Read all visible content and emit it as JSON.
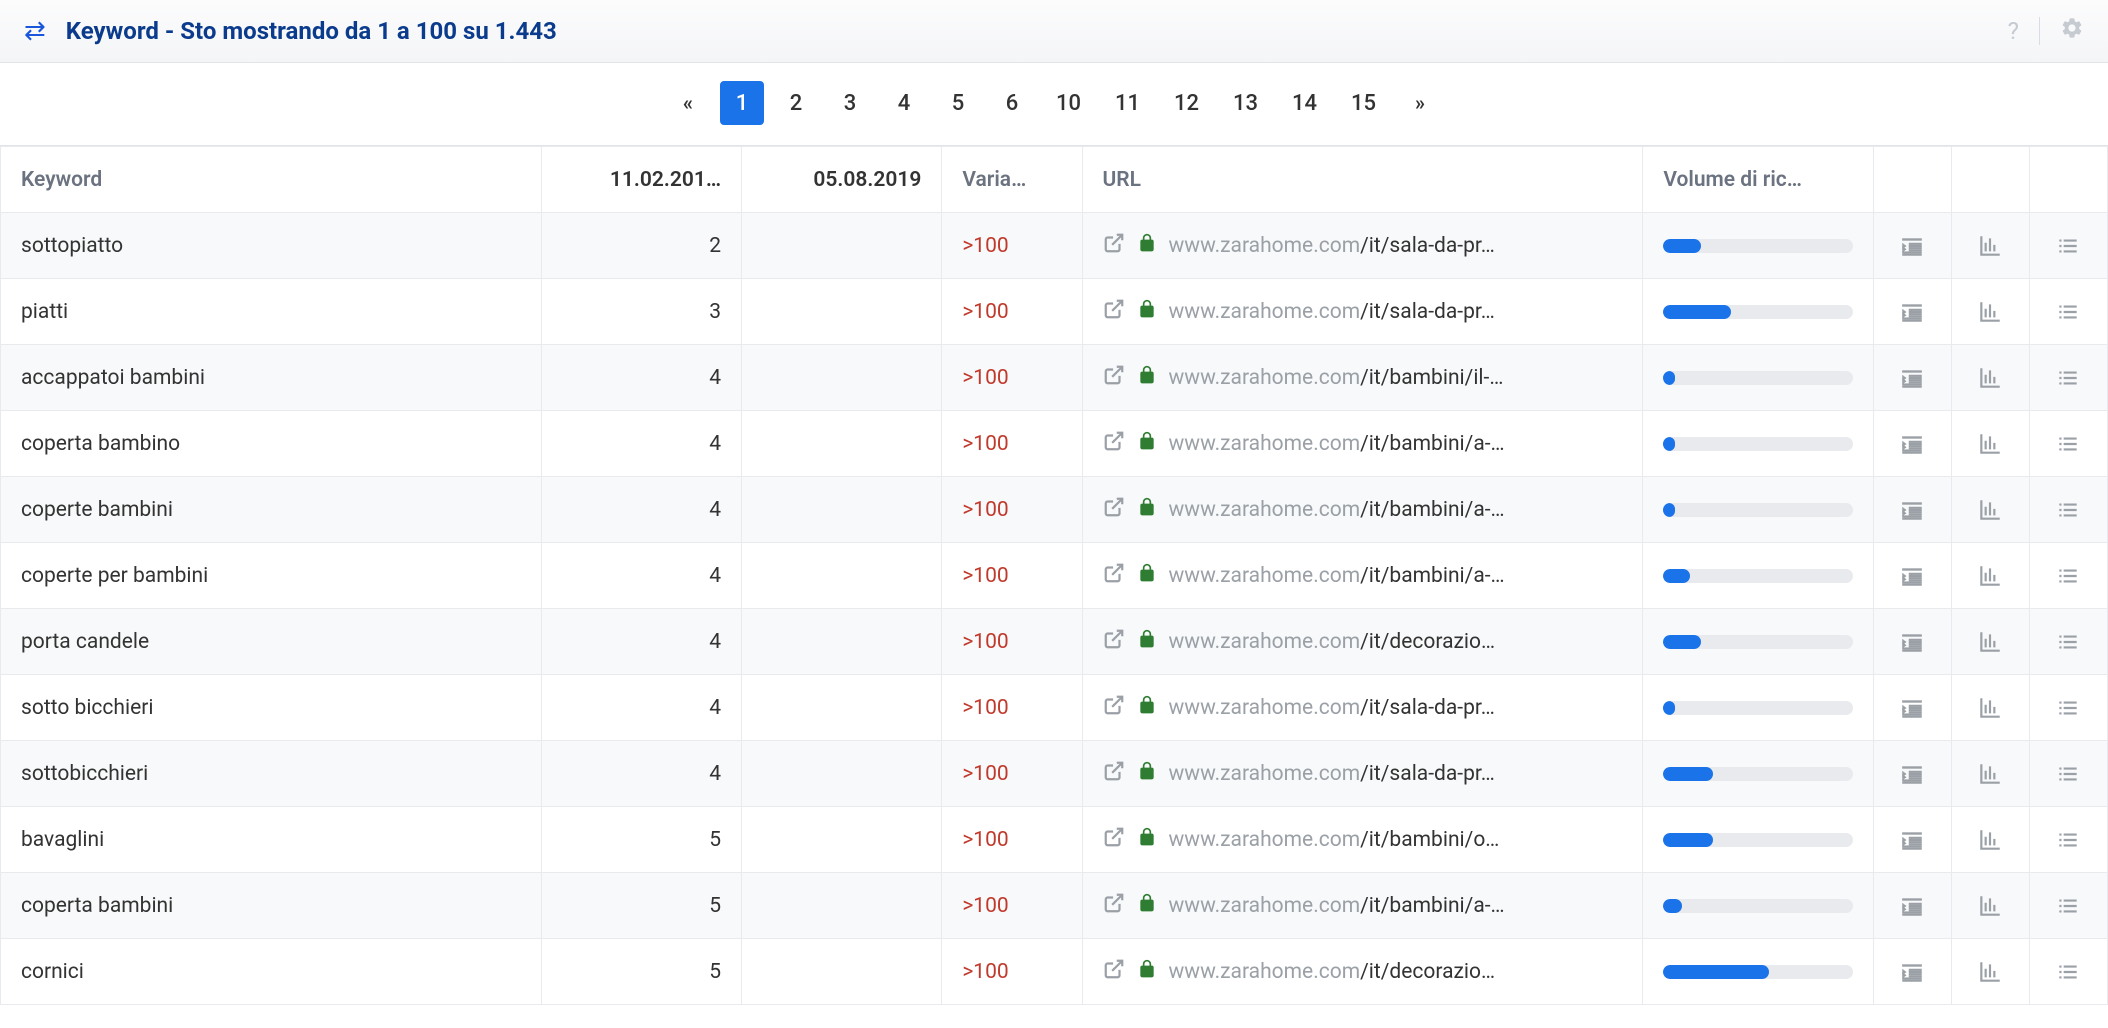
{
  "header": {
    "title": "Keyword - Sto mostrando da 1 a 100 su 1.443"
  },
  "pagination": {
    "prev": "«",
    "next": "»",
    "pages": [
      "1",
      "2",
      "3",
      "4",
      "5",
      "6",
      "10",
      "11",
      "12",
      "13",
      "14",
      "15"
    ],
    "active": "1"
  },
  "columns": {
    "keyword": "Keyword",
    "date1": "11.02.201…",
    "date2": "05.08.2019",
    "variation": "Varia…",
    "url": "URL",
    "volume": "Volume di ric…"
  },
  "rows": [
    {
      "keyword": "sottopiatto",
      "v1": "2",
      "v2": "",
      "var": ">100",
      "domain": "www.zarahome.com",
      "path": "/it/sala-da-pr…",
      "vol": 20
    },
    {
      "keyword": "piatti",
      "v1": "3",
      "v2": "",
      "var": ">100",
      "domain": "www.zarahome.com",
      "path": "/it/sala-da-pr…",
      "vol": 36
    },
    {
      "keyword": "accappatoi bambini",
      "v1": "4",
      "v2": "",
      "var": ">100",
      "domain": "www.zarahome.com",
      "path": "/it/bambini/il-…",
      "vol": 6
    },
    {
      "keyword": "coperta bambino",
      "v1": "4",
      "v2": "",
      "var": ">100",
      "domain": "www.zarahome.com",
      "path": "/it/bambini/a-…",
      "vol": 6
    },
    {
      "keyword": "coperte bambini",
      "v1": "4",
      "v2": "",
      "var": ">100",
      "domain": "www.zarahome.com",
      "path": "/it/bambini/a-…",
      "vol": 6
    },
    {
      "keyword": "coperte per bambini",
      "v1": "4",
      "v2": "",
      "var": ">100",
      "domain": "www.zarahome.com",
      "path": "/it/bambini/a-…",
      "vol": 14
    },
    {
      "keyword": "porta candele",
      "v1": "4",
      "v2": "",
      "var": ">100",
      "domain": "www.zarahome.com",
      "path": "/it/decorazio…",
      "vol": 20
    },
    {
      "keyword": "sotto bicchieri",
      "v1": "4",
      "v2": "",
      "var": ">100",
      "domain": "www.zarahome.com",
      "path": "/it/sala-da-pr…",
      "vol": 6
    },
    {
      "keyword": "sottobicchieri",
      "v1": "4",
      "v2": "",
      "var": ">100",
      "domain": "www.zarahome.com",
      "path": "/it/sala-da-pr…",
      "vol": 26
    },
    {
      "keyword": "bavaglini",
      "v1": "5",
      "v2": "",
      "var": ">100",
      "domain": "www.zarahome.com",
      "path": "/it/bambini/o…",
      "vol": 26
    },
    {
      "keyword": "coperta bambini",
      "v1": "5",
      "v2": "",
      "var": ">100",
      "domain": "www.zarahome.com",
      "path": "/it/bambini/a-…",
      "vol": 10
    },
    {
      "keyword": "cornici",
      "v1": "5",
      "v2": "",
      "var": ">100",
      "domain": "www.zarahome.com",
      "path": "/it/decorazio…",
      "vol": 56
    }
  ]
}
